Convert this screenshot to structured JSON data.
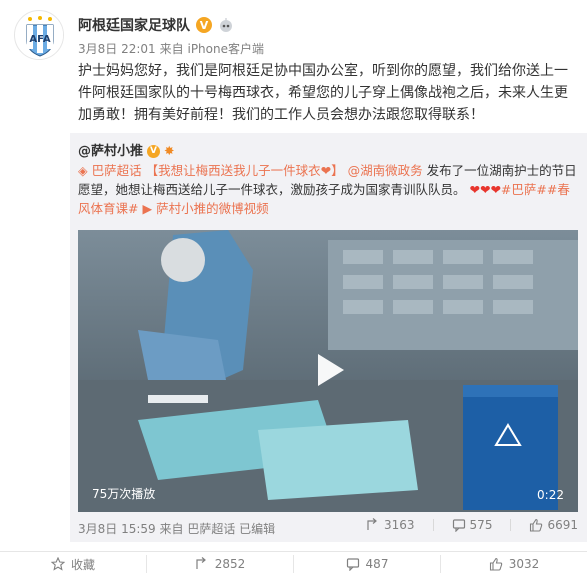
{
  "account": {
    "name": "阿根廷国家足球队",
    "time": "3月8日 22:01",
    "source": "来自 iPhone客户端"
  },
  "post": {
    "text": "护士妈妈您好，我们是阿根廷足协中国办公室，听到你的愿望，我们给你送上一件阿根廷国家队的十号梅西球衣，希望您的儿子穿上偶像战袍之后，未来人生更加勇敢！拥有美好前程！我们的工作人员会想办法跟您取得联系！"
  },
  "repost": {
    "author": "@萨村小推",
    "topic1": "巴萨超话",
    "topic2": "【我想让梅西送我儿子一件球衣❤】",
    "mention": "@湖南微政务",
    "text": "发布了一位湖南护士的节日愿望，她想让梅西送给儿子一件球衣，激励孩子成为国家青训队队员。",
    "hearts": "❤❤❤",
    "tag1": "#巴萨#",
    "tag2": "#春风体育课#",
    "video_link": "萨村小推的微博视频",
    "video": {
      "views": "75万次播放",
      "duration": "0:22"
    },
    "footer": {
      "time": "3月8日 15:59",
      "source": "来自 巴萨超话",
      "edited": "已编辑",
      "reposts": "3163",
      "comments": "575",
      "likes": "6691"
    }
  },
  "actions": {
    "favorite": "收藏",
    "repost": "2852",
    "comment": "487",
    "like": "3032"
  },
  "colors": {
    "link": "#eb7350",
    "muted": "#808080",
    "repost_bg": "#f2f2f5"
  }
}
